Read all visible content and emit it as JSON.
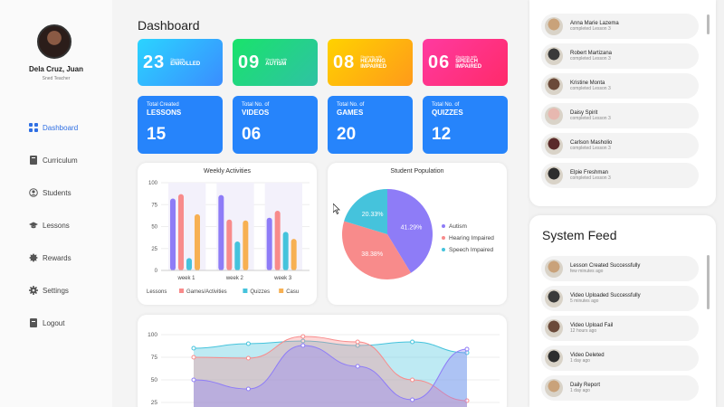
{
  "user": {
    "name": "Dela Cruz, Juan",
    "role": "Sned Teacher"
  },
  "nav": [
    {
      "label": "Dashboard",
      "icon": "grid-icon",
      "active": true
    },
    {
      "label": "Curriculum",
      "icon": "book-icon",
      "active": false
    },
    {
      "label": "Students",
      "icon": "user-circle-icon",
      "active": false
    },
    {
      "label": "Lessons",
      "icon": "graduation-cap-icon",
      "active": false
    },
    {
      "label": "Rewards",
      "icon": "badge-icon",
      "active": false
    },
    {
      "label": "Settings",
      "icon": "gear-icon",
      "active": false
    },
    {
      "label": "Logout",
      "icon": "logout-icon",
      "active": false
    }
  ],
  "page": {
    "title": "Dashboard"
  },
  "stats": [
    {
      "value": "23",
      "small": "Students",
      "big": "ENROLLED"
    },
    {
      "value": "09",
      "small": "Students with",
      "big": "AUTISM"
    },
    {
      "value": "08",
      "small": "Students with",
      "big": "HEARING IMPAIRED"
    },
    {
      "value": "06",
      "small": "Students with",
      "big": "SPEECH IMPAIRED"
    }
  ],
  "totals": [
    {
      "small": "Total Created",
      "big": "LESSONS",
      "value": "15"
    },
    {
      "small": "Total No. of",
      "big": "VIDEOS",
      "value": "06"
    },
    {
      "small": "Total No. of",
      "big": "GAMES",
      "value": "20"
    },
    {
      "small": "Total No. of",
      "big": "QUIZZES",
      "value": "12"
    }
  ],
  "chart_data": [
    {
      "type": "bar",
      "title": "Weekly Activities",
      "categories": [
        "week 1",
        "week 2",
        "week 3"
      ],
      "ylim": [
        0,
        100
      ],
      "yticks": [
        "100",
        "75",
        "50",
        "25",
        "0"
      ],
      "series": [
        {
          "name": "Lessons",
          "color": "#8e7cf7",
          "values": [
            82,
            86,
            60
          ]
        },
        {
          "name": "Games/Activities",
          "color": "#f88b8b",
          "values": [
            87,
            58,
            68
          ]
        },
        {
          "name": "Quizzes",
          "color": "#45c3dc",
          "values": [
            14,
            33,
            44
          ]
        },
        {
          "name": "Casu",
          "color": "#f7b052",
          "values": [
            64,
            57,
            36
          ]
        }
      ],
      "legend": "bottom"
    },
    {
      "type": "pie",
      "title": "Student Population",
      "series": [
        {
          "name": "Autism",
          "value": 41.29,
          "label": "41.29%",
          "color": "#8e7cf7"
        },
        {
          "name": "Hearing Impaired",
          "value": 38.38,
          "label": "38.38%",
          "color": "#f88b8b"
        },
        {
          "name": "Speech Impaired",
          "value": 20.33,
          "label": "20.33%",
          "color": "#45c3dc"
        }
      ],
      "legend": "right"
    },
    {
      "type": "area",
      "ylim": [
        25,
        100
      ],
      "yticks": [
        "100",
        "75",
        "50",
        "25"
      ],
      "series": [
        {
          "color": "#45c3dc",
          "values": [
            85,
            90,
            93,
            88,
            92,
            80
          ]
        },
        {
          "color": "#f88b8b",
          "values": [
            75,
            74,
            98,
            92,
            50,
            27
          ]
        },
        {
          "color": "#8e7cf7",
          "values": [
            50,
            40,
            88,
            65,
            28,
            84
          ]
        }
      ]
    }
  ],
  "recent": [
    {
      "name": "Anna Marie Lazema",
      "sub": "completed Lesson 3",
      "color": "#c9a27a"
    },
    {
      "name": "Robert Martizana",
      "sub": "completed Lesson 3",
      "color": "#3a3a3a"
    },
    {
      "name": "Kristine Monta",
      "sub": "completed Lesson 3",
      "color": "#6b4a3a"
    },
    {
      "name": "Daisy Spirit",
      "sub": "completed Lesson 3",
      "color": "#e7b8b0"
    },
    {
      "name": "Carlson Masholio",
      "sub": "completed Lesson 3",
      "color": "#5a2a2a"
    },
    {
      "name": "Elpie Freshman",
      "sub": "completed Lesson 3",
      "color": "#2e2e2e"
    }
  ],
  "feed": {
    "title": "System Feed",
    "items": [
      {
        "name": "Lesson Created Successfully",
        "sub": "few minutes ago",
        "color": "#c9a27a"
      },
      {
        "name": "Video Uploaded Successfully",
        "sub": "5 minutes ago",
        "color": "#3a3a3a"
      },
      {
        "name": "Video Upload Fail",
        "sub": "12 hours ago",
        "color": "#6b4a3a"
      },
      {
        "name": "Video Deleted",
        "sub": "1 day ago",
        "color": "#2e2e2e"
      },
      {
        "name": "Daily Report",
        "sub": "1 day ago",
        "color": "#c9a27a"
      }
    ]
  }
}
